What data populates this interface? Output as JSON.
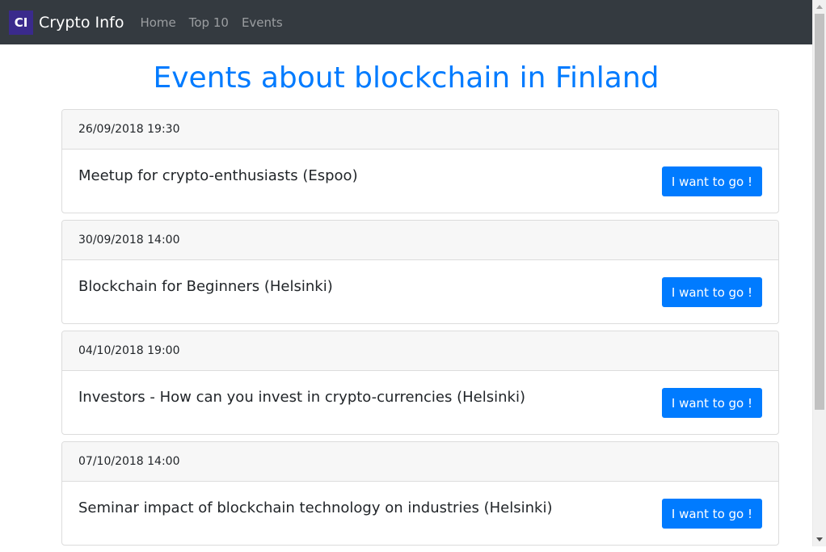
{
  "navbar": {
    "logo_text": "CI",
    "brand_name": "Crypto Info",
    "links": [
      {
        "label": "Home"
      },
      {
        "label": "Top 10"
      },
      {
        "label": "Events"
      }
    ]
  },
  "page": {
    "title": "Events about blockchain in Finland"
  },
  "events": [
    {
      "datetime": "26/09/2018 19:30",
      "title": "Meetup for crypto-enthusiasts (Espoo)",
      "button_label": "I want to go !"
    },
    {
      "datetime": "30/09/2018 14:00",
      "title": "Blockchain for Beginners (Helsinki)",
      "button_label": "I want to go !"
    },
    {
      "datetime": "04/10/2018 19:00",
      "title": "Investors - How can you invest in crypto-currencies (Helsinki)",
      "button_label": "I want to go !"
    },
    {
      "datetime": "07/10/2018 14:00",
      "title": "Seminar impact of blockchain technology on industries (Helsinki)",
      "button_label": "I want to go !"
    }
  ],
  "colors": {
    "navbar_bg": "#343a40",
    "logo_bg": "#3a2a8c",
    "accent": "#007bff",
    "card_header_bg": "#f7f7f7"
  }
}
